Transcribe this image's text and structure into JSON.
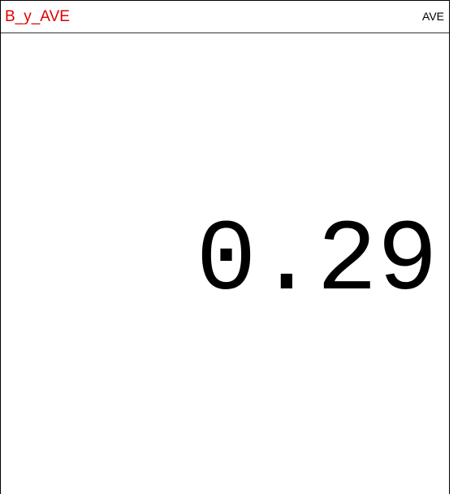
{
  "widget": {
    "title": "B_y_AVE",
    "title_color": "#e00000",
    "mode_label": "AVE",
    "value": "0.29"
  }
}
